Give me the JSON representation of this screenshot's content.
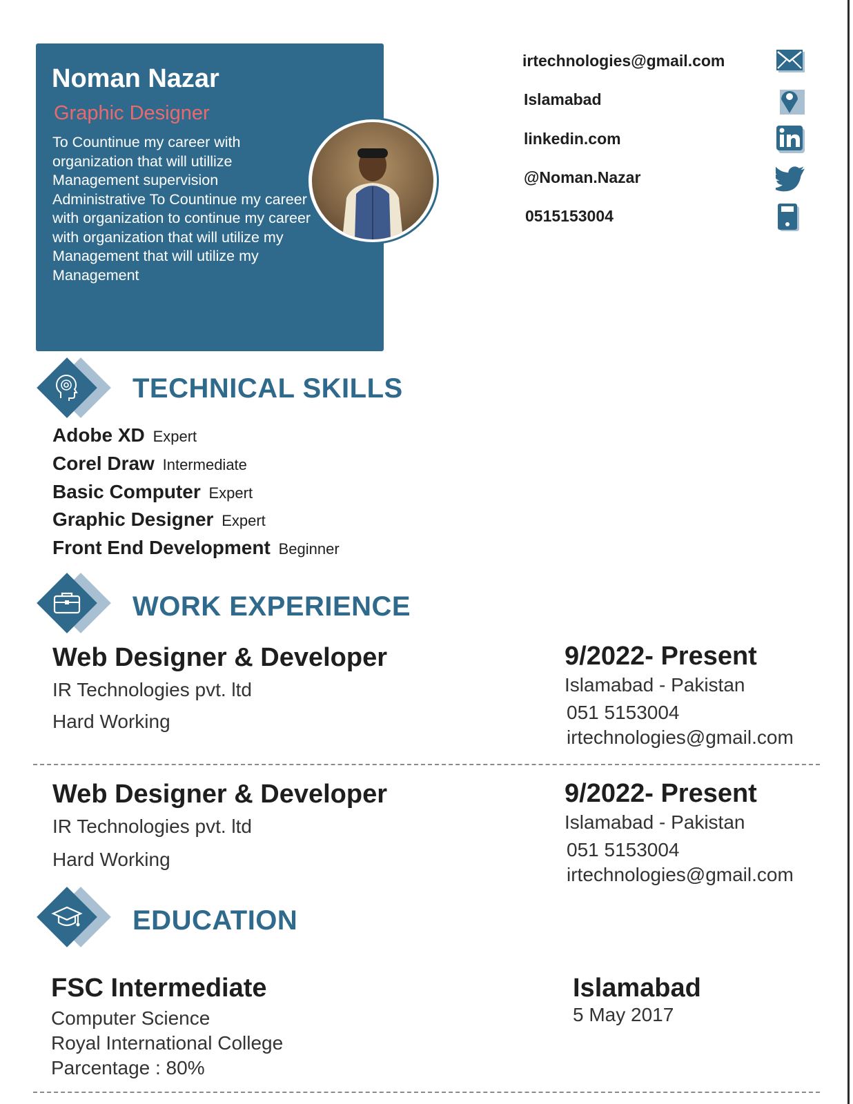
{
  "profile": {
    "name": "Noman Nazar",
    "title": "Graphic Designer",
    "summary": "To Countinue my career with organization that will utillize Management supervision Administrative To Countinue my  career with organization to continue my career with organization that will utilize my Management that will utilize my Management"
  },
  "contact": {
    "email": "irtechnologies@gmail.com",
    "location": "Islamabad",
    "linkedin": "linkedin.com",
    "twitter": "@Noman.Nazar",
    "phone": "0515153004"
  },
  "skills": {
    "heading": "TECHNICAL SKILLS",
    "items": [
      {
        "name": "Adobe XD",
        "level": "Expert"
      },
      {
        "name": "Corel Draw",
        "level": "Intermediate"
      },
      {
        "name": "Basic Computer",
        "level": "Expert"
      },
      {
        "name": "Graphic Designer",
        "level": "Expert"
      },
      {
        "name": "Front End Development",
        "level": "Beginner"
      }
    ]
  },
  "experience": {
    "heading": "WORK EXPERIENCE",
    "jobs": [
      {
        "title": "Web Designer & Developer",
        "company": "IR Technologies pvt. ltd",
        "note": "Hard Working",
        "date": "9/2022- Present",
        "location": "Islamabad - Pakistan",
        "phone": "051 5153004",
        "email": "irtechnologies@gmail.com"
      },
      {
        "title": "Web Designer & Developer",
        "company": "IR Technologies pvt. ltd",
        "note": "Hard Working",
        "date": "9/2022- Present",
        "location": "Islamabad - Pakistan",
        "phone": "051 5153004",
        "email": "irtechnologies@gmail.com"
      }
    ]
  },
  "education": {
    "heading": "EDUCATION",
    "degree": "FSC Intermediate",
    "field": "Computer Science",
    "school": "Royal International College",
    "percentage": "Parcentage : 80%",
    "city": "Islamabad",
    "date": "5 May 2017"
  },
  "colors": {
    "accent": "#2f6a8d",
    "accent_light": "#a9c0d3",
    "role": "#e86a6e"
  },
  "icons": [
    "mail-icon",
    "location-pin-icon",
    "linkedin-icon",
    "twitter-icon",
    "phone-icon",
    "brain-icon",
    "briefcase-icon",
    "graduation-cap-icon"
  ]
}
